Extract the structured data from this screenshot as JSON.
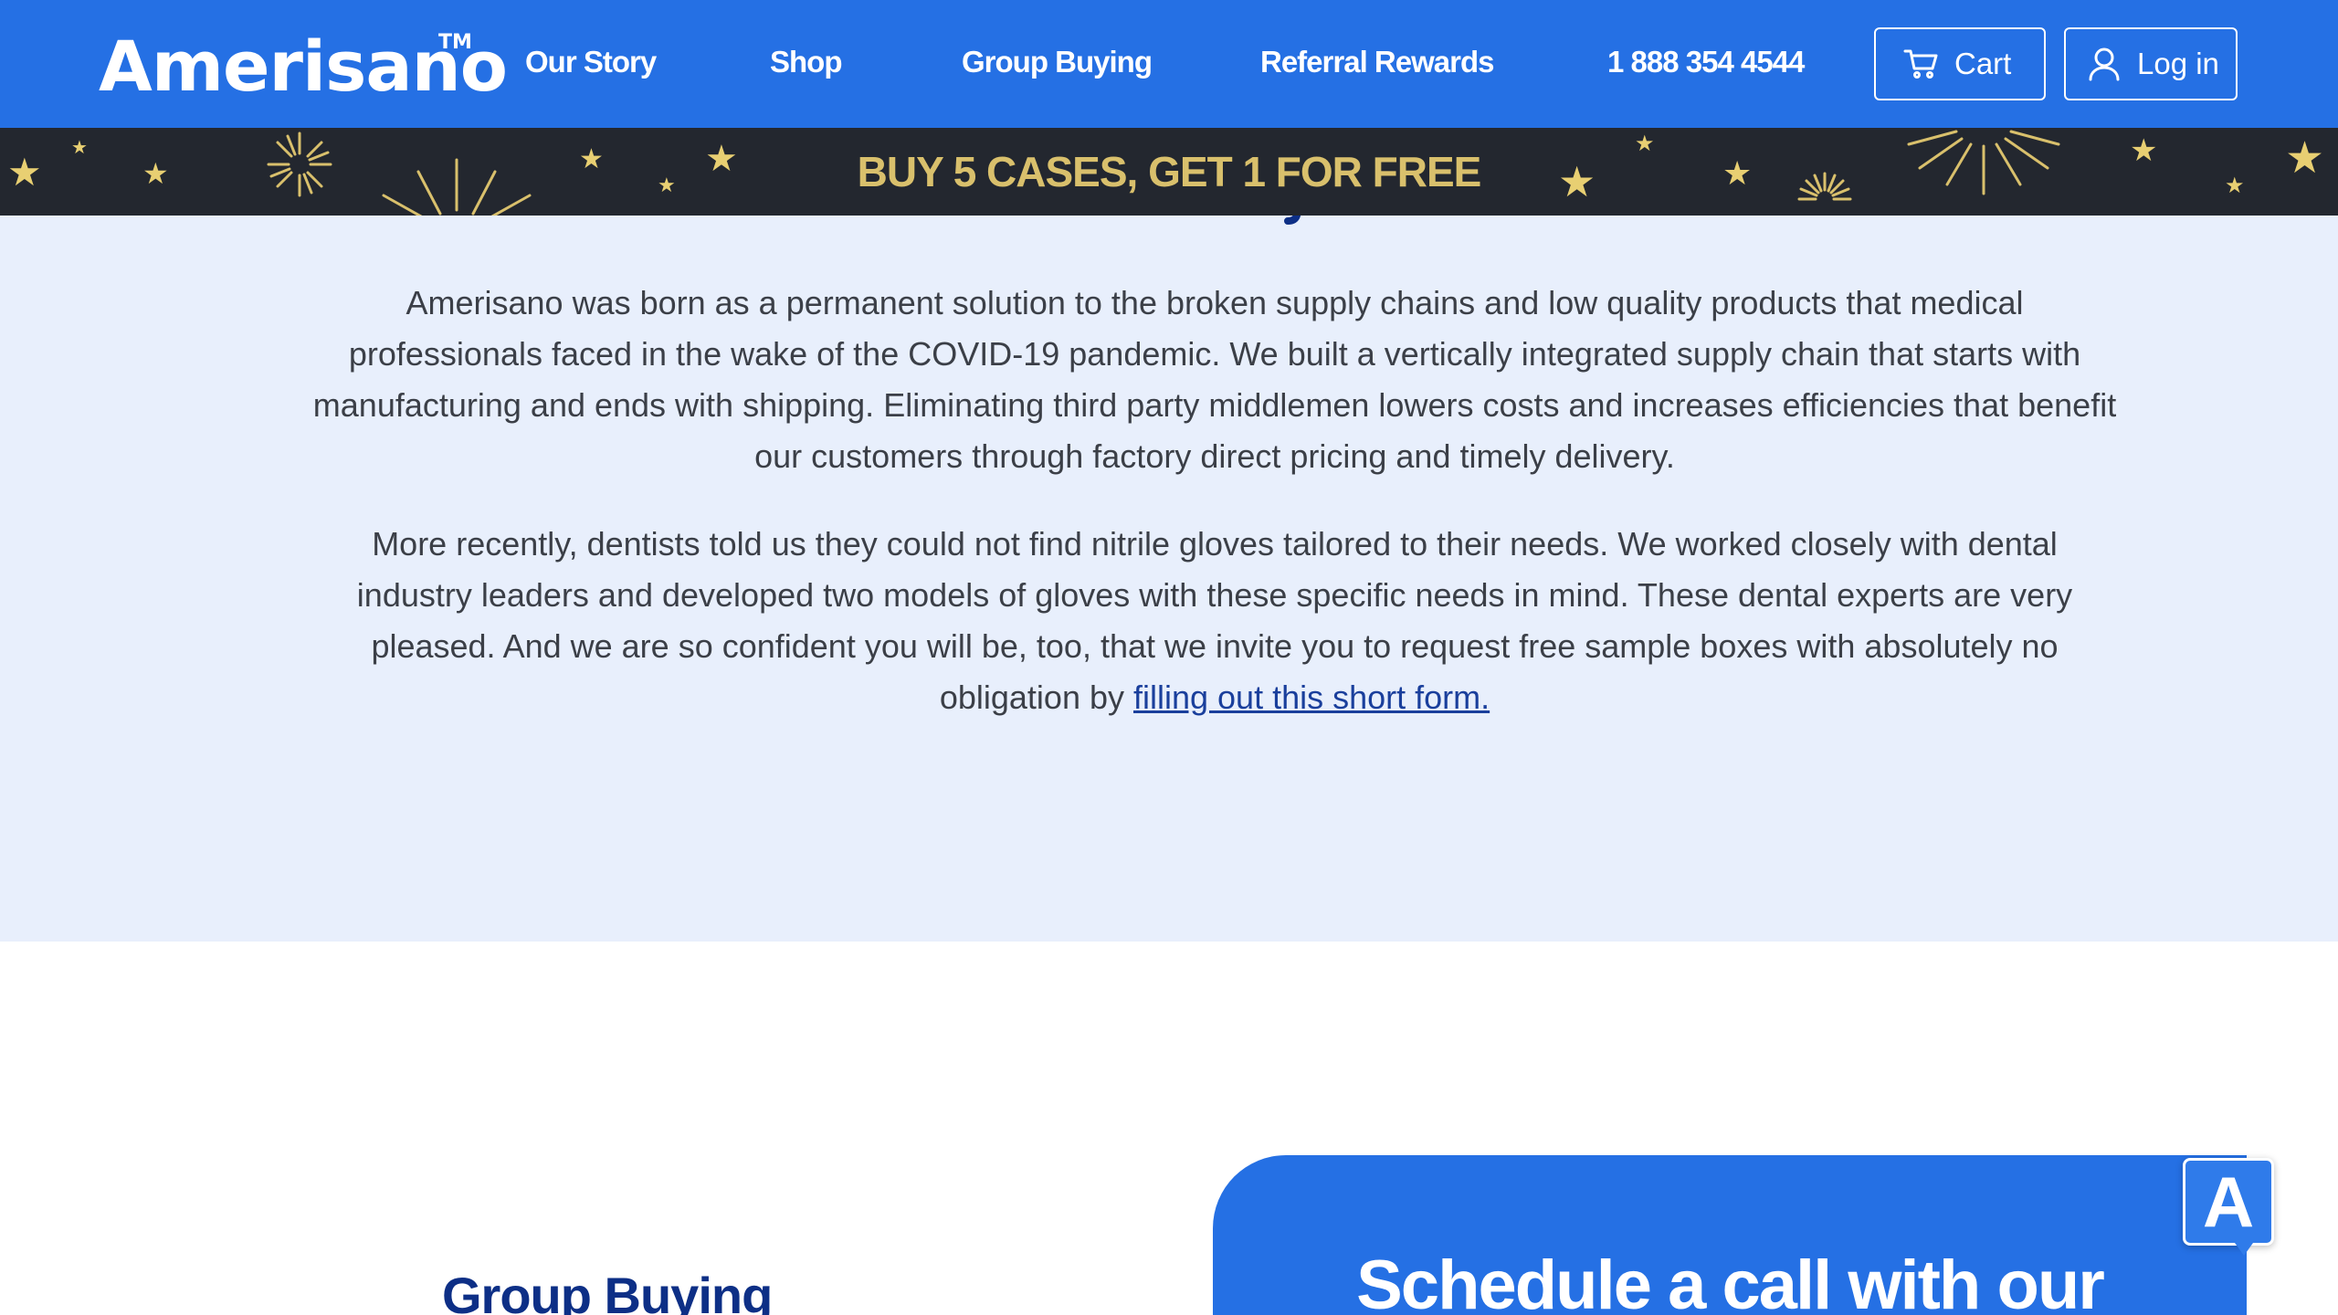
{
  "header": {
    "logo": "Amerisano",
    "logo_tm": "TM",
    "nav": [
      "Our Story",
      "Shop",
      "Group Buying",
      "Referral Rewards"
    ],
    "phone": "1 888 354 4544",
    "cart_label": "Cart",
    "login_label": "Log in",
    "colors": {
      "background": "#2570e4",
      "text": "#ffffff"
    }
  },
  "promo": {
    "text": "BUY 5 CASES, GET 1 FOR FREE",
    "colors": {
      "background": "#23272f",
      "text": "#d9c06c"
    }
  },
  "story": {
    "paragraph1": "Amerisano was born as a permanent solution to the broken supply chains and low quality products that medical professionals faced in the wake of the COVID-19 pandemic. We built a vertically integrated supply chain that starts with manufacturing and ends with shipping. Eliminating third party middlemen lowers costs and increases efficiencies that benefit our customers through factory direct pricing and timely delivery.",
    "paragraph2_text": "More recently, dentists told us they could not find nitrile gloves tailored to their needs. We worked closely with dental industry leaders and developed two models of gloves with these specific needs in mind. These dental experts are very pleased. And we are so confident you will be, too, that we invite you to request free sample boxes with absolutely no obligation by ",
    "paragraph2_link": "filling out this short form.",
    "colors": {
      "background": "#e8effc",
      "text": "#3b3f47",
      "link": "#1a3f9c"
    }
  },
  "group_buying": {
    "heading": "Group Buying"
  },
  "schedule": {
    "title": "Schedule a call with our"
  },
  "accessibility": {
    "label": "A"
  }
}
